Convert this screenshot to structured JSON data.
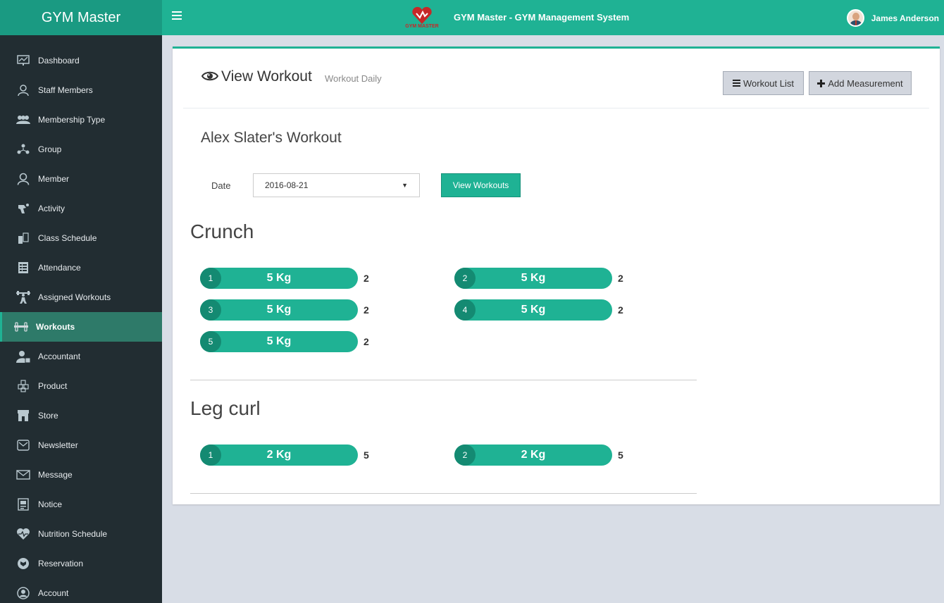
{
  "header": {
    "brand": "GYM Master",
    "app_title": "GYM Master - GYM Management System",
    "logo_text": "GYM MASTER",
    "user_name": "James Anderson"
  },
  "sidebar": {
    "items": [
      {
        "label": "Dashboard",
        "icon": "dashboard-icon",
        "active": false
      },
      {
        "label": "Staff Members",
        "icon": "staff-icon",
        "active": false
      },
      {
        "label": "Membership Type",
        "icon": "membership-icon",
        "active": false
      },
      {
        "label": "Group",
        "icon": "group-icon",
        "active": false
      },
      {
        "label": "Member",
        "icon": "member-icon",
        "active": false
      },
      {
        "label": "Activity",
        "icon": "activity-icon",
        "active": false
      },
      {
        "label": "Class Schedule",
        "icon": "class-schedule-icon",
        "active": false
      },
      {
        "label": "Attendance",
        "icon": "attendance-icon",
        "active": false
      },
      {
        "label": "Assigned Workouts",
        "icon": "assigned-workouts-icon",
        "active": false
      },
      {
        "label": "Workouts",
        "icon": "workouts-icon",
        "active": true
      },
      {
        "label": "Accountant",
        "icon": "accountant-icon",
        "active": false
      },
      {
        "label": "Product",
        "icon": "product-icon",
        "active": false
      },
      {
        "label": "Store",
        "icon": "store-icon",
        "active": false
      },
      {
        "label": "Newsletter",
        "icon": "newsletter-icon",
        "active": false
      },
      {
        "label": "Message",
        "icon": "message-icon",
        "active": false
      },
      {
        "label": "Notice",
        "icon": "notice-icon",
        "active": false
      },
      {
        "label": "Nutrition Schedule",
        "icon": "nutrition-icon",
        "active": false
      },
      {
        "label": "Reservation",
        "icon": "reservation-icon",
        "active": false
      },
      {
        "label": "Account",
        "icon": "account-icon",
        "active": false
      }
    ]
  },
  "page": {
    "title": "View Workout",
    "subtitle": "Workout Daily",
    "workout_list_label": "Workout List",
    "add_measurement_label": "Add Measurement",
    "member_title": "Alex Slater's Workout",
    "date_label": "Date",
    "date_value": "2016-08-21",
    "view_button_label": "View Workouts"
  },
  "workouts": [
    {
      "name": "Crunch",
      "sets": [
        {
          "num": "1",
          "weight": "5 Kg",
          "reps": "2"
        },
        {
          "num": "2",
          "weight": "5 Kg",
          "reps": "2"
        },
        {
          "num": "3",
          "weight": "5 Kg",
          "reps": "2"
        },
        {
          "num": "4",
          "weight": "5 Kg",
          "reps": "2"
        },
        {
          "num": "5",
          "weight": "5 Kg",
          "reps": "2"
        }
      ]
    },
    {
      "name": "Leg curl",
      "sets": [
        {
          "num": "1",
          "weight": "2 Kg",
          "reps": "5"
        },
        {
          "num": "2",
          "weight": "2 Kg",
          "reps": "5"
        }
      ]
    }
  ],
  "colors": {
    "accent": "#1fb294",
    "accent_dark": "#148a72",
    "sidebar_bg": "#222d32",
    "brand_bg": "#1a9a82"
  }
}
